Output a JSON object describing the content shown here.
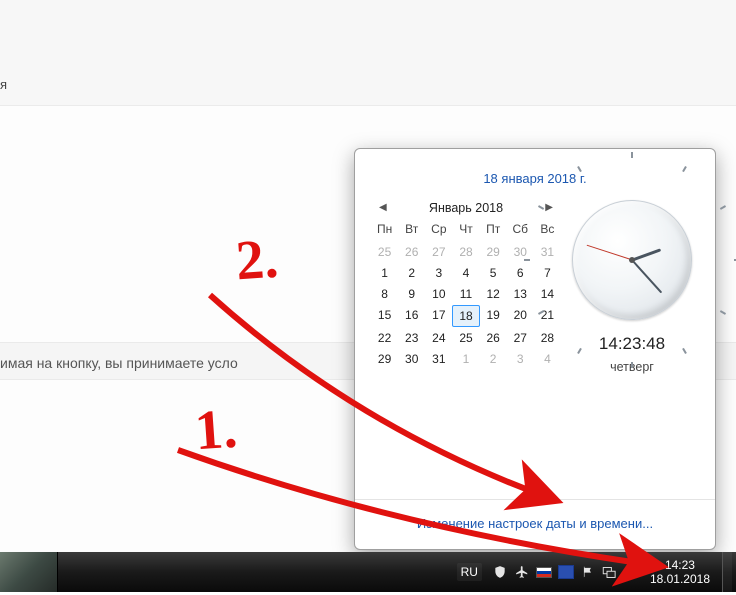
{
  "fragments": {
    "top_text": "я",
    "terms_text": "имая на кнопку, вы принимаете усло"
  },
  "popup": {
    "date_full": "18 января 2018 г.",
    "month_label": "Январь 2018",
    "weekdays": [
      "Пн",
      "Вт",
      "Ср",
      "Чт",
      "Пт",
      "Сб",
      "Вс"
    ],
    "days": [
      {
        "n": "25",
        "other": true
      },
      {
        "n": "26",
        "other": true
      },
      {
        "n": "27",
        "other": true
      },
      {
        "n": "28",
        "other": true
      },
      {
        "n": "29",
        "other": true
      },
      {
        "n": "30",
        "other": true
      },
      {
        "n": "31",
        "other": true
      },
      {
        "n": "1"
      },
      {
        "n": "2"
      },
      {
        "n": "3"
      },
      {
        "n": "4"
      },
      {
        "n": "5"
      },
      {
        "n": "6"
      },
      {
        "n": "7"
      },
      {
        "n": "8"
      },
      {
        "n": "9"
      },
      {
        "n": "10"
      },
      {
        "n": "11"
      },
      {
        "n": "12"
      },
      {
        "n": "13"
      },
      {
        "n": "14"
      },
      {
        "n": "15"
      },
      {
        "n": "16"
      },
      {
        "n": "17"
      },
      {
        "n": "18",
        "selected": true
      },
      {
        "n": "19"
      },
      {
        "n": "20"
      },
      {
        "n": "21"
      },
      {
        "n": "22"
      },
      {
        "n": "23"
      },
      {
        "n": "24"
      },
      {
        "n": "25"
      },
      {
        "n": "26"
      },
      {
        "n": "27"
      },
      {
        "n": "28"
      },
      {
        "n": "29"
      },
      {
        "n": "30"
      },
      {
        "n": "31"
      },
      {
        "n": "1",
        "other": true
      },
      {
        "n": "2",
        "other": true
      },
      {
        "n": "3",
        "other": true
      },
      {
        "n": "4",
        "other": true
      }
    ],
    "digital_time": "14:23:48",
    "weekday_name": "четверг",
    "settings_link": "Изменение настроек даты и времени..."
  },
  "taskbar": {
    "lang": "RU",
    "time": "14:23",
    "date": "18.01.2018"
  },
  "annotations": {
    "label1": "1.",
    "label2": "2."
  }
}
